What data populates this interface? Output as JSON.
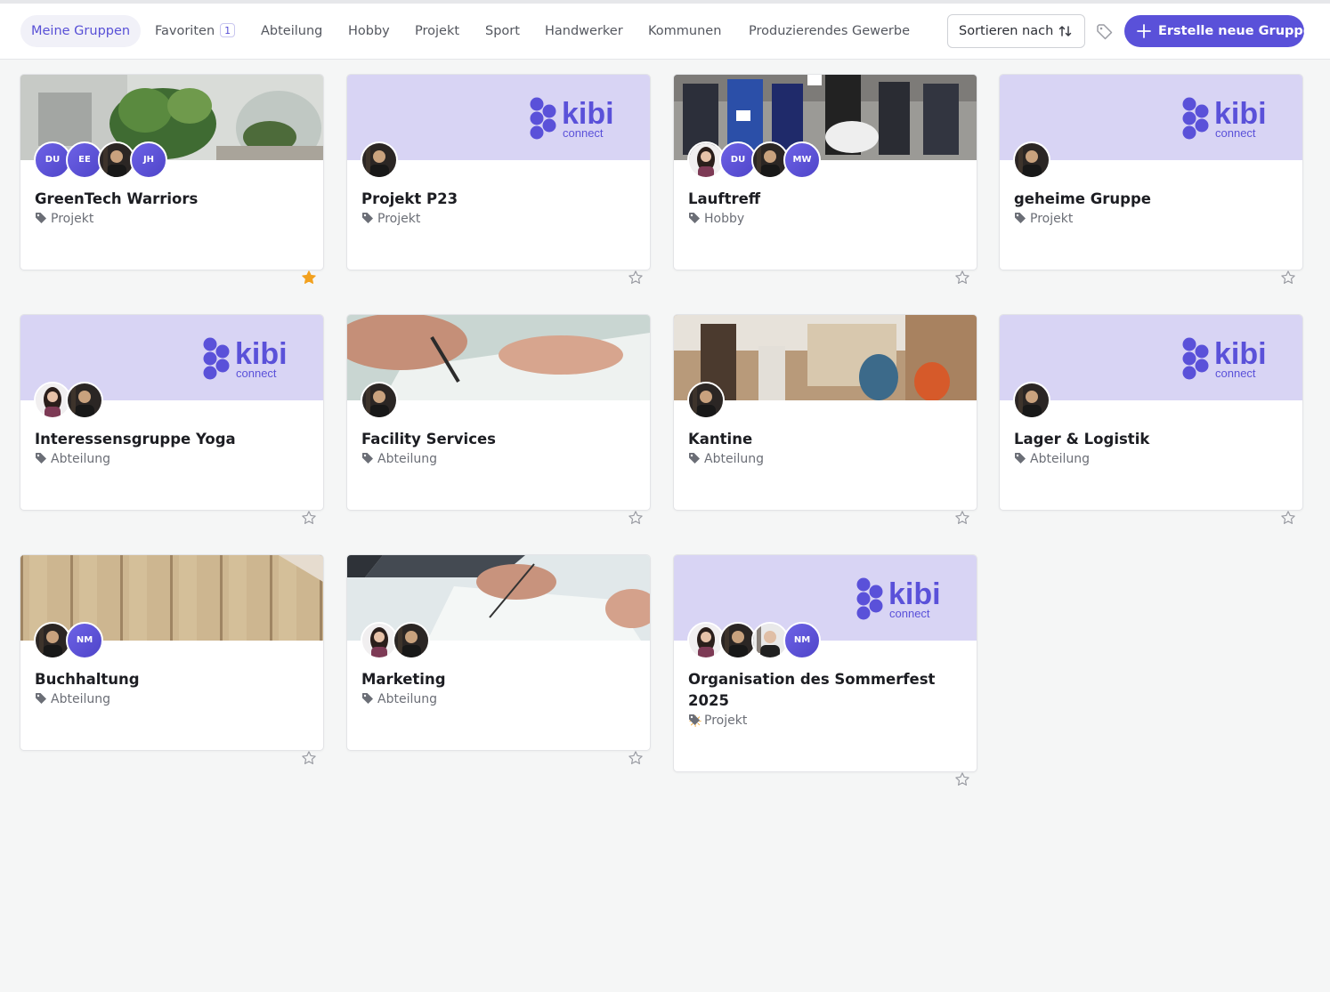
{
  "tabs": [
    {
      "label": "Meine Gruppen",
      "active": true
    },
    {
      "label": "Favoriten",
      "badge": "1"
    },
    {
      "label": "Abteilung"
    },
    {
      "label": "Hobby"
    },
    {
      "label": "Projekt"
    },
    {
      "label": "Sport"
    },
    {
      "label": "Handwerker"
    },
    {
      "label": "Kommunen"
    },
    {
      "label": "Produzierendes Gewerbe"
    }
  ],
  "toolbar": {
    "sort_label": "Sortieren nach",
    "create_label": "Erstelle neue Gruppe"
  },
  "colors": {
    "accent": "#5a51d9",
    "banner_lavender": "#d8d4f4",
    "star_active": "#f2a11f",
    "star_inactive": "#9a9ca3"
  },
  "brand": {
    "logo_word": "kibi",
    "logo_sub": "connect"
  },
  "groups": [
    {
      "title": "GreenTech Warriors",
      "category": "Projekt",
      "banner": "plants",
      "favorite": true,
      "members": [
        "DU",
        "EE",
        "photo-man",
        "JH"
      ]
    },
    {
      "title": "Projekt P23",
      "category": "Projekt",
      "banner": "logo",
      "favorite": false,
      "members": [
        "photo-man"
      ]
    },
    {
      "title": "Lauftreff",
      "category": "Hobby",
      "banner": "runners",
      "favorite": false,
      "members": [
        "photo-woman",
        "DU",
        "photo-man",
        "MW"
      ]
    },
    {
      "title": "geheime Gruppe",
      "category": "Projekt",
      "banner": "logo",
      "favorite": false,
      "members": [
        "photo-man"
      ]
    },
    {
      "title": "Interessensgruppe Yoga",
      "category": "Abteilung",
      "banner": "logo",
      "favorite": false,
      "members": [
        "photo-woman",
        "photo-man"
      ]
    },
    {
      "title": "Facility Services",
      "category": "Abteilung",
      "banner": "writing",
      "favorite": false,
      "members": [
        "photo-man"
      ]
    },
    {
      "title": "Kantine",
      "category": "Abteilung",
      "banner": "cafe",
      "favorite": false,
      "members": [
        "photo-man"
      ]
    },
    {
      "title": "Lager & Logistik",
      "category": "Abteilung",
      "banner": "logo",
      "favorite": false,
      "members": [
        "photo-man"
      ]
    },
    {
      "title": "Buchhaltung",
      "category": "Abteilung",
      "banner": "wood",
      "favorite": false,
      "members": [
        "photo-man",
        "NM"
      ]
    },
    {
      "title": "Marketing",
      "category": "Abteilung",
      "banner": "laptop",
      "favorite": false,
      "members": [
        "photo-woman",
        "photo-man"
      ]
    },
    {
      "title": "Organisation des Sommerfest 2025",
      "title_emoji": "☀",
      "category": "Projekt",
      "banner": "logo",
      "favorite": false,
      "members": [
        "photo-woman",
        "photo-man",
        "photo-man2",
        "NM"
      ]
    }
  ]
}
